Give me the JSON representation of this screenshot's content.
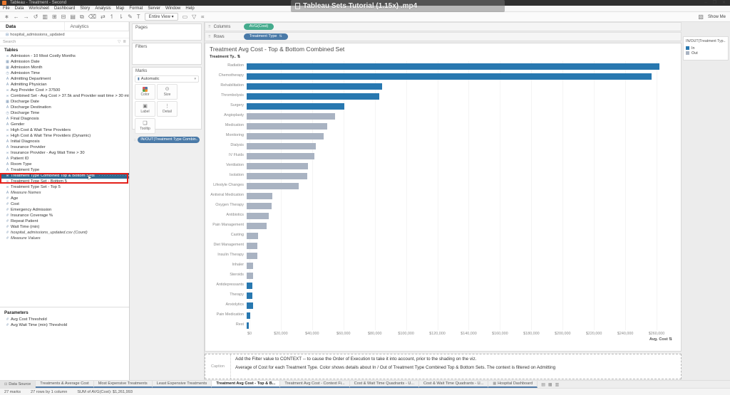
{
  "window": {
    "title": "Tableau - Treatment - Second",
    "controls": [
      "–",
      "❐",
      "✕"
    ]
  },
  "video_overlay": {
    "title": "Tableau Sets Tutorial (1.15x) .mp4"
  },
  "menu": {
    "items": [
      "File",
      "Data",
      "Worksheet",
      "Dashboard",
      "Story",
      "Analysis",
      "Map",
      "Format",
      "Server",
      "Window",
      "Help"
    ]
  },
  "toolbar": {
    "fit_selector": "Entire View",
    "show_me": "Show Me",
    "icons_left": [
      {
        "name": "tableau-logo-icon",
        "glyph": "∗"
      },
      {
        "name": "back-icon",
        "glyph": "←"
      },
      {
        "name": "forward-icon",
        "glyph": "→"
      },
      {
        "name": "replay-icon",
        "glyph": "↺"
      },
      {
        "name": "save-icon",
        "glyph": "▥"
      },
      {
        "name": "add-datasource-icon",
        "glyph": "⊞"
      },
      {
        "name": "pause-updates-icon",
        "glyph": "⊟"
      },
      {
        "name": "new-worksheet-icon",
        "glyph": "▤"
      },
      {
        "name": "duplicate-icon",
        "glyph": "⧉"
      },
      {
        "name": "clear-sheet-icon",
        "glyph": "⌫"
      },
      {
        "name": "swap-axes-icon",
        "glyph": "⇄"
      },
      {
        "name": "sort-ascending-icon",
        "glyph": "↿"
      },
      {
        "name": "sort-descending-icon",
        "glyph": "⇂"
      },
      {
        "name": "highlight-icon",
        "glyph": "✎"
      },
      {
        "name": "show-labels-icon",
        "glyph": "T"
      }
    ],
    "icons_right": [
      {
        "name": "device-preview-icon",
        "glyph": "▭"
      },
      {
        "name": "presentation-mode-icon",
        "glyph": "▽"
      },
      {
        "name": "share-icon",
        "glyph": "∝"
      }
    ]
  },
  "data_pane": {
    "tabs": [
      "Data",
      "Analytics"
    ],
    "connection": "hospital_admissions_updated",
    "search_placeholder": "Search",
    "tables_header": "Tables",
    "fields": [
      {
        "label": "Admission - 10 Most Costly Months",
        "type": "set"
      },
      {
        "label": "Admission Date",
        "type": "date"
      },
      {
        "label": "Admission Month",
        "type": "date"
      },
      {
        "label": "Admission Time",
        "type": "time"
      },
      {
        "label": "Admitting Department",
        "type": "string"
      },
      {
        "label": "Admitting Physician",
        "type": "string"
      },
      {
        "label": "Avg Provider Cost > 37500",
        "type": "set"
      },
      {
        "label": "Combined Set - Avg Cost > 37.5k and Provider wait time > 30 min",
        "type": "set"
      },
      {
        "label": "Discharge Date",
        "type": "date"
      },
      {
        "label": "Discharge Destination",
        "type": "string"
      },
      {
        "label": "Discharge Time",
        "type": "time"
      },
      {
        "label": "Final Diagnosis",
        "type": "string"
      },
      {
        "label": "Gender",
        "type": "string"
      },
      {
        "label": "High Cost & Wait Time Providers",
        "type": "set"
      },
      {
        "label": "High Cost & Wait Time Providers (Dynamic)",
        "type": "set"
      },
      {
        "label": "Initial Diagnosis",
        "type": "string"
      },
      {
        "label": "Insurance Provider",
        "type": "string"
      },
      {
        "label": "Insurance Provider - Avg Wait Time > 30",
        "type": "set"
      },
      {
        "label": "Patient ID",
        "type": "string"
      },
      {
        "label": "Room Type",
        "type": "string"
      },
      {
        "label": "Treatment Type",
        "type": "string"
      },
      {
        "label": "Treatment Type Combined Top & Bottom Sets",
        "type": "set",
        "selected": true
      },
      {
        "label": "Treatment Type Set - Bottom 5",
        "type": "set"
      },
      {
        "label": "Treatment Type Set - Top 5",
        "type": "set"
      },
      {
        "label": "Measure Names",
        "type": "string",
        "italic": true
      },
      {
        "label": "Age",
        "type": "number"
      },
      {
        "label": "Cost",
        "type": "number"
      },
      {
        "label": "Emergency Admission",
        "type": "number"
      },
      {
        "label": "Insurance Coverage %",
        "type": "number"
      },
      {
        "label": "Repeat Patient",
        "type": "number"
      },
      {
        "label": "Wait Time (min)",
        "type": "number"
      },
      {
        "label": "hospital_admissions_updated.csv (Count)",
        "type": "number",
        "italic": true
      },
      {
        "label": "Measure Values",
        "type": "number",
        "italic": true
      }
    ],
    "parameters_header": "Parameters",
    "parameters": [
      "Avg Cost Threshold",
      "Avg Wait Time (min) Threshold"
    ]
  },
  "cards": {
    "pages_label": "Pages",
    "filters_label": "Filters",
    "marks": {
      "title": "Marks",
      "mark_type": "Automatic",
      "buttons": [
        {
          "label": "Color",
          "icon": "color-swatch"
        },
        {
          "label": "Size",
          "icon": "⊙"
        },
        {
          "label": "Label",
          "icon": "▣"
        },
        {
          "label": "Detail",
          "icon": "⋮"
        },
        {
          "label": "Tooltip",
          "icon": "❑"
        }
      ],
      "pill": "IN/OUT(Treatment Type Combin.."
    }
  },
  "shelves": {
    "columns_label": "Columns",
    "columns_pill": "AVG(Cost)",
    "rows_label": "Rows",
    "rows_pill": "Treatment Type"
  },
  "sheet": {
    "title": "Treatment Avg Cost - Top & Bottom Combined Set",
    "row_header": "Treatment Ty.. ⇅",
    "caption_label": "Caption",
    "caption_lines": [
      "Add the Filter value to CONTEXT -- to cause the Order of Execution to take it into account, prior to the shading on the viz.",
      "Average of Cost for each Treatment Type.  Color shows details about In / Out of Treatment Type Combined Top & Bottom Sets. The context is filtered on Admitting"
    ]
  },
  "legend": {
    "title": "IN/OUT(Treatment Typ...",
    "items": [
      {
        "label": "In",
        "color": "#2878b0"
      },
      {
        "label": "Out",
        "color": "#a9b3c2"
      }
    ]
  },
  "chart_data": {
    "type": "bar",
    "orientation": "horizontal",
    "title": "Treatment Avg Cost - Top & Bottom Combined Set",
    "xlabel": "Avg. Cost",
    "ylabel": "Treatment Type",
    "xlim": [
      0,
      270000
    ],
    "x_ticks": [
      0,
      20000,
      40000,
      60000,
      80000,
      100000,
      120000,
      140000,
      160000,
      180000,
      200000,
      220000,
      240000,
      260000
    ],
    "grid": true,
    "legend_position": "top-right",
    "categories": [
      "Radiation",
      "Chemotherapy",
      "Rehabilitation",
      "Thrombolysis",
      "Surgery",
      "Angioplasty",
      "Medication",
      "Monitoring",
      "Dialysis",
      "IV Fluids",
      "Ventilation",
      "Isolation",
      "Lifestyle Changes",
      "Antiviral Medication",
      "Oxygen Therapy",
      "Antibiotics",
      "Pain Management",
      "Casting",
      "Diet Management",
      "Insulin Therapy",
      "Inhaler",
      "Steroids",
      "Antidepressants",
      "Therapy",
      "Anxiolytics",
      "Pain Medication",
      "Rest"
    ],
    "values": [
      262000,
      257000,
      86000,
      84000,
      62000,
      56000,
      51000,
      49000,
      44000,
      43000,
      39000,
      38500,
      33000,
      16500,
      16000,
      14000,
      12500,
      7200,
      7000,
      7000,
      4200,
      4000,
      3800,
      3600,
      4000,
      2200,
      1200
    ],
    "set_membership": [
      "In",
      "In",
      "In",
      "In",
      "In",
      "Out",
      "Out",
      "Out",
      "Out",
      "Out",
      "Out",
      "Out",
      "Out",
      "Out",
      "Out",
      "Out",
      "Out",
      "Out",
      "Out",
      "Out",
      "Out",
      "Out",
      "In",
      "In",
      "In",
      "In",
      "In"
    ],
    "colors": {
      "in": "#2878b0",
      "out": "#a9b3c2"
    }
  },
  "tabs_bar": {
    "tabs": [
      {
        "label": "Data Source",
        "icon": "⊟",
        "first": true
      },
      {
        "label": "Treatments & Average Cost"
      },
      {
        "label": "Most Expensive Treatments"
      },
      {
        "label": "Least Expensive Treatments"
      },
      {
        "label": "Treatment Avg Cost - Top & B...",
        "active": true
      },
      {
        "label": "Treatment Avg Cost - Context Fi..."
      },
      {
        "label": "Cost & Wait Time Quadrants - U..."
      },
      {
        "label": "Cost & Wait Time Quadrants - U..."
      },
      {
        "label": "Hospital Dashboard",
        "icon": "▦"
      }
    ]
  },
  "status_bar": {
    "items": [
      "27 marks",
      "27 rows by 1 column",
      "SUM of AVG(Cost): $1,261,993"
    ]
  }
}
